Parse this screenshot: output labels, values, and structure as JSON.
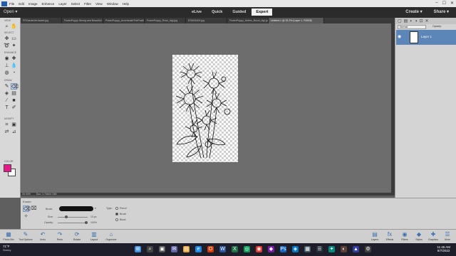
{
  "menubar": {
    "items": [
      "File",
      "Edit",
      "Image",
      "Enhance",
      "Layer",
      "Select",
      "Filter",
      "View",
      "Window",
      "Help"
    ],
    "window_controls": [
      "–",
      "☐",
      "✕"
    ]
  },
  "modebar": {
    "open_label": "Open ▾",
    "modes": [
      "eLive",
      "Quick",
      "Guided",
      "Expert"
    ],
    "create_label": "Create ▾",
    "share_label": "Share ▾"
  },
  "tabs": [
    "PRGardeLifeJacket.jpg",
    "PowerPoppy Strong and Beautiful 12.jpg",
    "PowerPoppy_AccentuateThePositive_digi_300.12.jpg",
    "PowerPoppy_Rose_digi.jpg",
    "ESM04409.jpg",
    "PowerPoppy_Asters_Blood_digi.jpg",
    "Untitled-1 @ 33.3% (Layer 1, RGB/8)"
  ],
  "toolbar": {
    "sections": [
      "VIEW",
      "SELECT",
      "ENHANCE",
      "DRAW",
      "MODIFY",
      "COLOR"
    ]
  },
  "status": {
    "zoom": "33.33%",
    "doc": "Doc: 1.74M/4.74M"
  },
  "layers_panel": {
    "blend_mode": "Normal",
    "opacity_label": "Opacity:",
    "layer_name": "Layer 1"
  },
  "tool_options": {
    "tool_name": "Eraser",
    "brush_label": "Brush:",
    "size_label": "Size:",
    "size_value": "13 px",
    "opacity_label": "Opacity:",
    "opacity_value": "100%",
    "type_label": "Type:",
    "type_options": [
      "Pencil",
      "Brush",
      "Block"
    ]
  },
  "bottom_bar": {
    "left": [
      "Photo Bin",
      "Tool Options",
      "Undo",
      "Redo",
      "Rotate",
      "Layout",
      "Organizer"
    ],
    "right": [
      "Layers",
      "Effects",
      "Filters",
      "Styles",
      "Graphics",
      "More"
    ]
  },
  "taskbar": {
    "temp": "71°F",
    "condition": "Sunny",
    "time": "11:46 AM",
    "date": "8/7/2022"
  }
}
